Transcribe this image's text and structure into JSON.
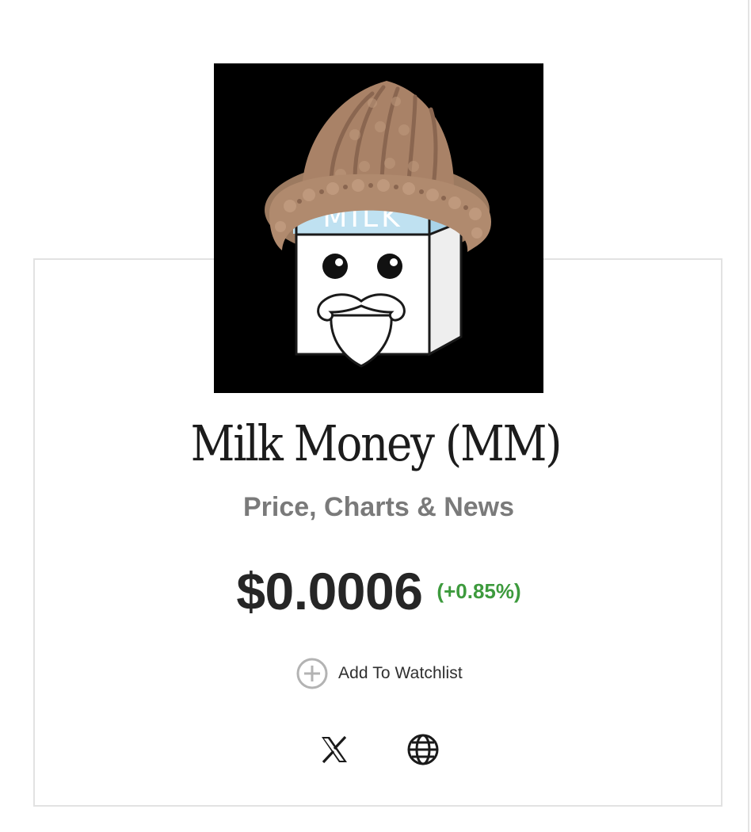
{
  "token": {
    "name": "Milk Money (MM)",
    "subtitle": "Price, Charts & News",
    "logo_text": "MILK",
    "logo_icon": "milk-carton-mascot-with-knit-hat"
  },
  "price": {
    "value": "$0.0006",
    "change": "(+0.85%)",
    "change_color": "#3d9a3d"
  },
  "watchlist": {
    "label": "Add To Watchlist",
    "icon": "plus-circle-icon"
  },
  "social": {
    "x_icon": "x-logo-icon",
    "web_icon": "globe-icon"
  },
  "colors": {
    "title": "#1c1c1c",
    "subtitle": "#7a7a7a",
    "price": "#262626",
    "border": "#e2e2e2"
  }
}
